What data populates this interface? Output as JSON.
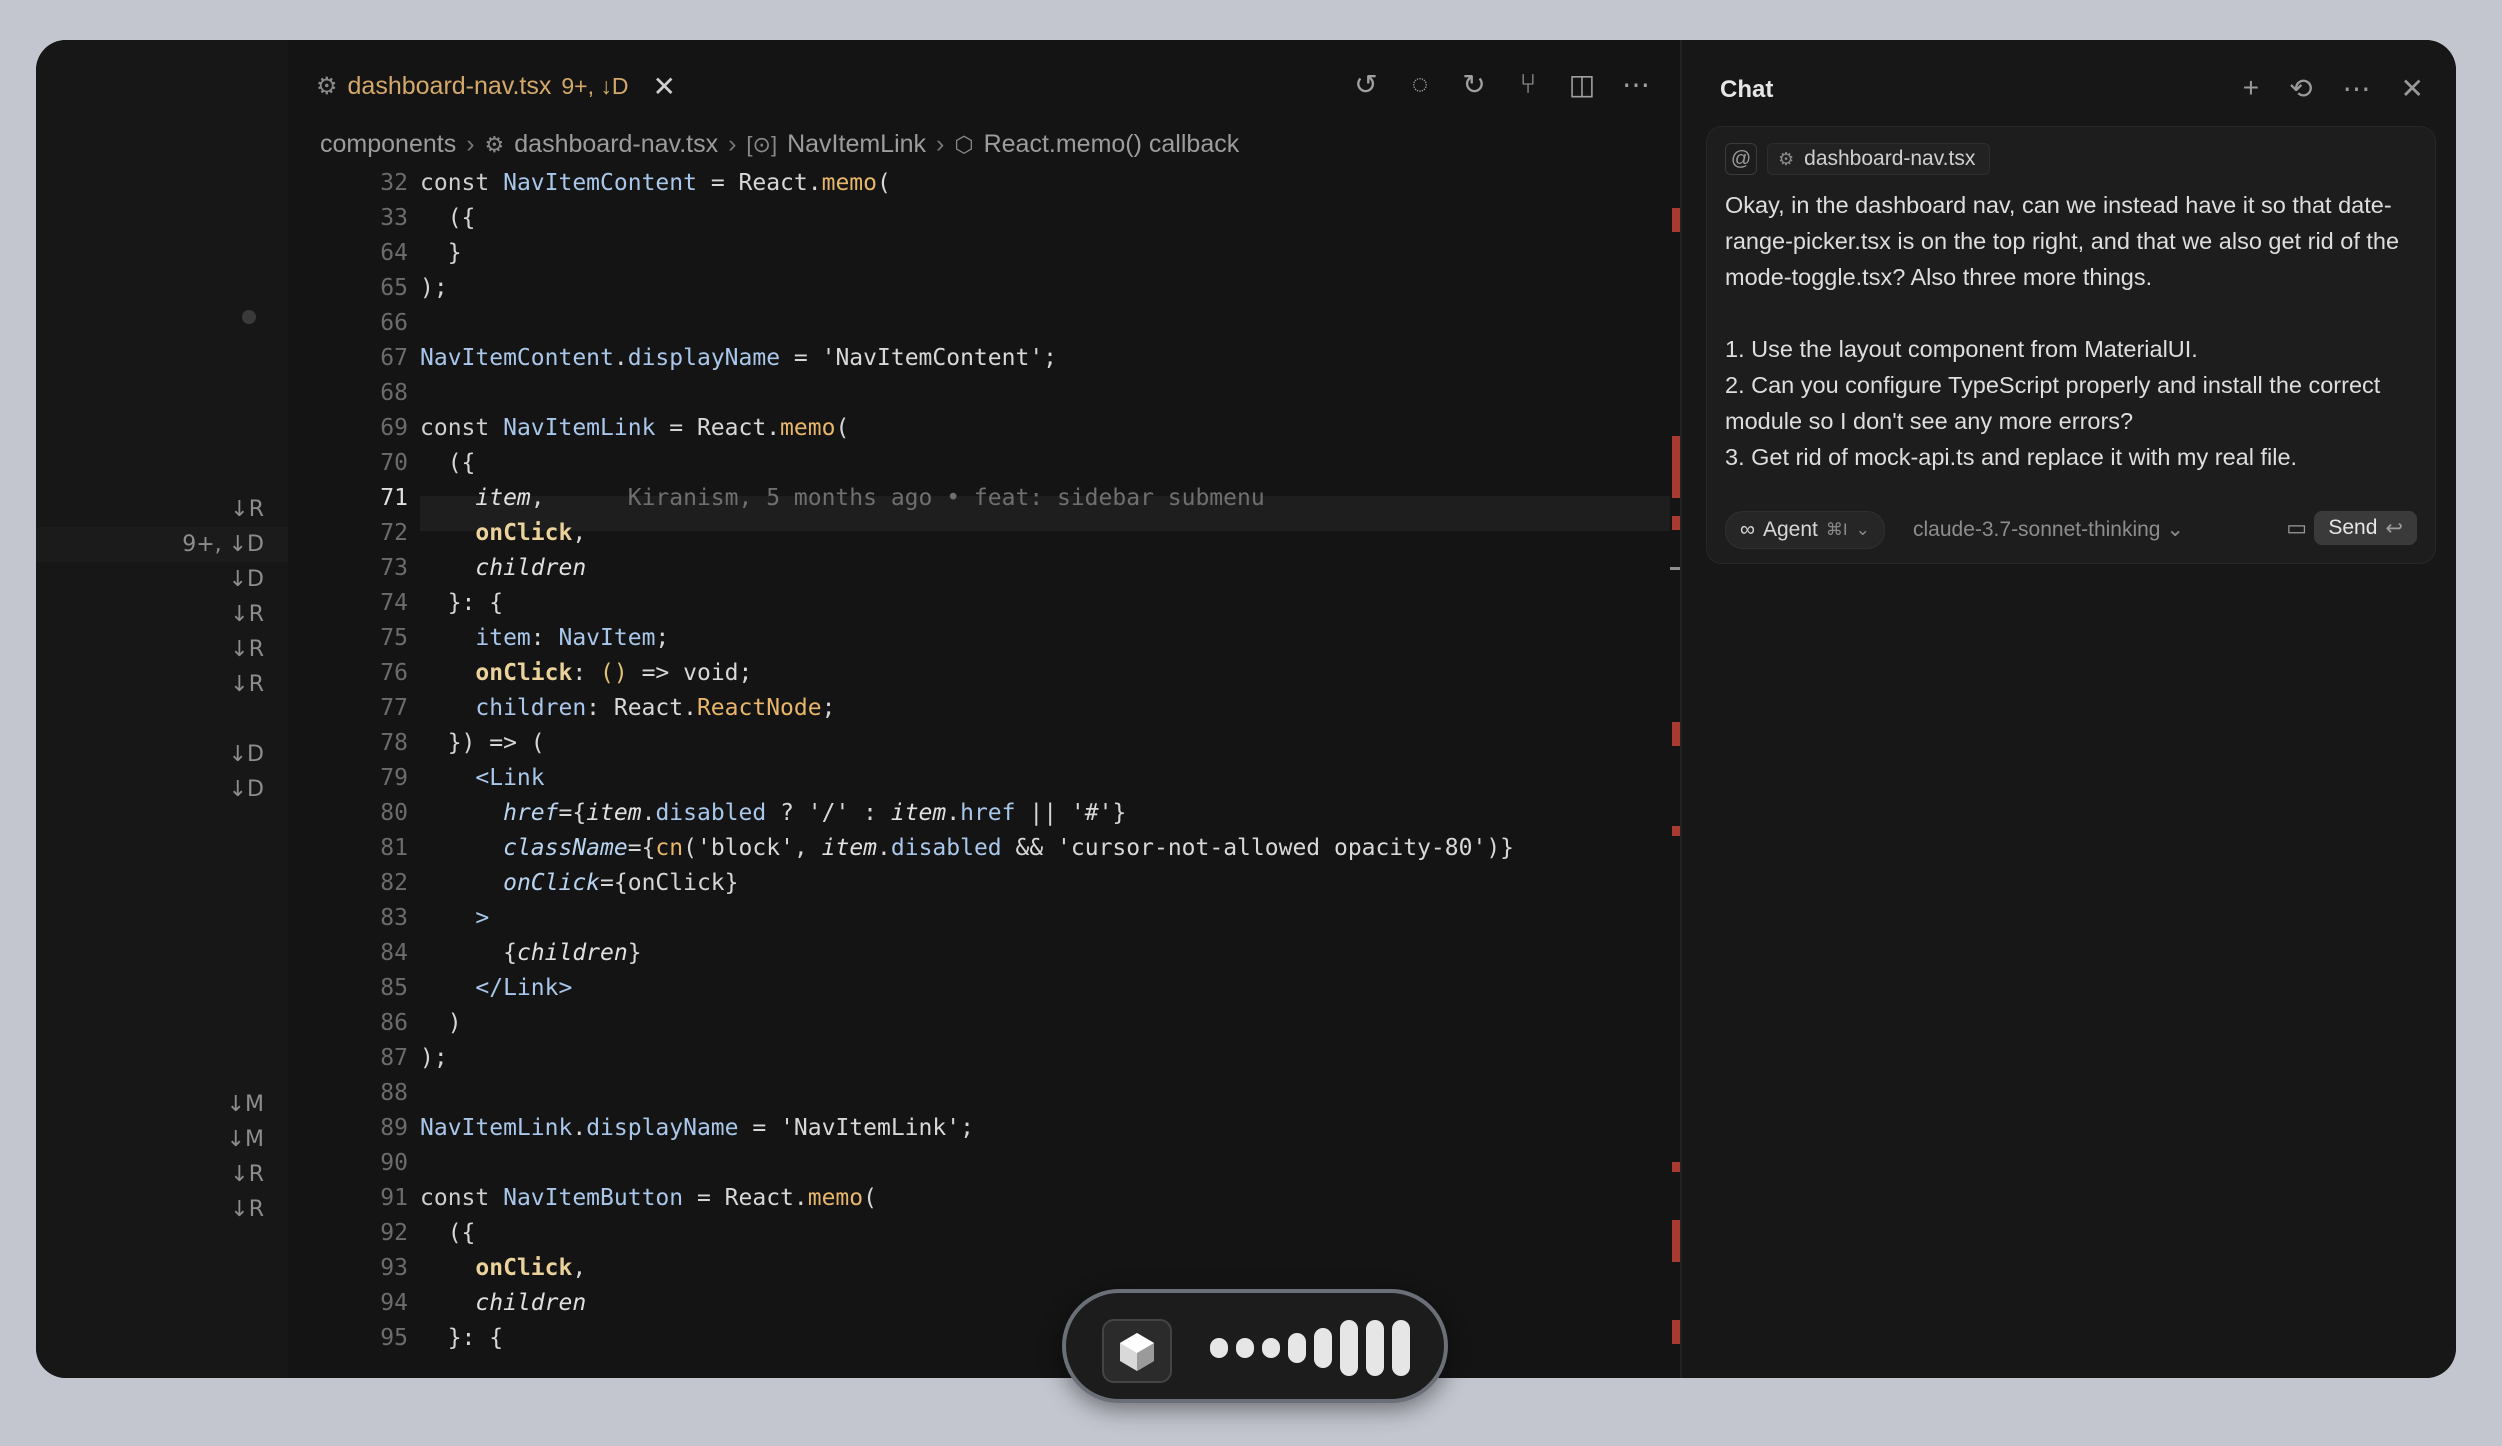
{
  "tab": {
    "filename": "dashboard-nav.tsx",
    "status": "9+, ↓D",
    "close": "✕"
  },
  "toolbar": {
    "icons": [
      "↺",
      "◌",
      "↻",
      "⑂",
      "◫",
      "⋯"
    ]
  },
  "breadcrumb": [
    {
      "label": "components",
      "icon": ""
    },
    {
      "label": "dashboard-nav.tsx",
      "icon": "⚙"
    },
    {
      "label": "NavItemLink",
      "icon": "[⊙]"
    },
    {
      "label": "React.memo() callback",
      "icon": "⬡"
    }
  ],
  "scm_markers": [
    {
      "line": "71",
      "label": "↓R"
    },
    {
      "line": "72",
      "label": "9+, ↓D"
    },
    {
      "line": "73",
      "label": "↓D"
    },
    {
      "line": "74",
      "label": "↓R"
    },
    {
      "line": "75",
      "label": "↓R"
    },
    {
      "line": "76",
      "label": "↓R"
    },
    {
      "line": "78",
      "label": "↓D"
    },
    {
      "line": "79",
      "label": "↓D"
    },
    {
      "line": "88",
      "label": "↓M"
    },
    {
      "line": "89",
      "label": "↓M"
    },
    {
      "line": "90",
      "label": "↓R"
    },
    {
      "line": "91",
      "label": "↓R"
    }
  ],
  "line_numbers": [
    "32",
    "33",
    "64",
    "65",
    "66",
    "67",
    "68",
    "69",
    "70",
    "71",
    "72",
    "73",
    "74",
    "75",
    "76",
    "77",
    "78",
    "79",
    "80",
    "81",
    "82",
    "83",
    "84",
    "85",
    "86",
    "87",
    "88",
    "89",
    "90",
    "91",
    "92",
    "93",
    "94",
    "95"
  ],
  "current_line": "71",
  "blame": "Kiranism, 5 months ago • feat: sidebar submenu",
  "chat": {
    "title": "Chat",
    "actions": [
      "+",
      "⟲",
      "⋯",
      "✕"
    ],
    "at_symbol": "@",
    "context_file": "dashboard-nav.tsx",
    "message_intro": "Okay, in the dashboard nav, can we instead have it so that date-range-picker.tsx is on the top right, and that we also get rid of the mode-toggle.tsx? Also three more things.",
    "items": [
      "1. Use the layout component from MaterialUI.",
      "2. Can you configure TypeScript properly and install the correct module so I don't see any more errors?",
      "3. Get rid of mock-api.ts and replace it with my real file."
    ],
    "mode": "Agent",
    "mode_shortcut": "⌘I",
    "model": "claude-3.7-sonnet-thinking",
    "send": "Send",
    "send_key": "↩"
  },
  "dock": {
    "bar_levels": [
      0.3,
      0.3,
      0.3,
      0.45,
      0.6,
      0.85,
      0.85,
      0.85
    ]
  }
}
